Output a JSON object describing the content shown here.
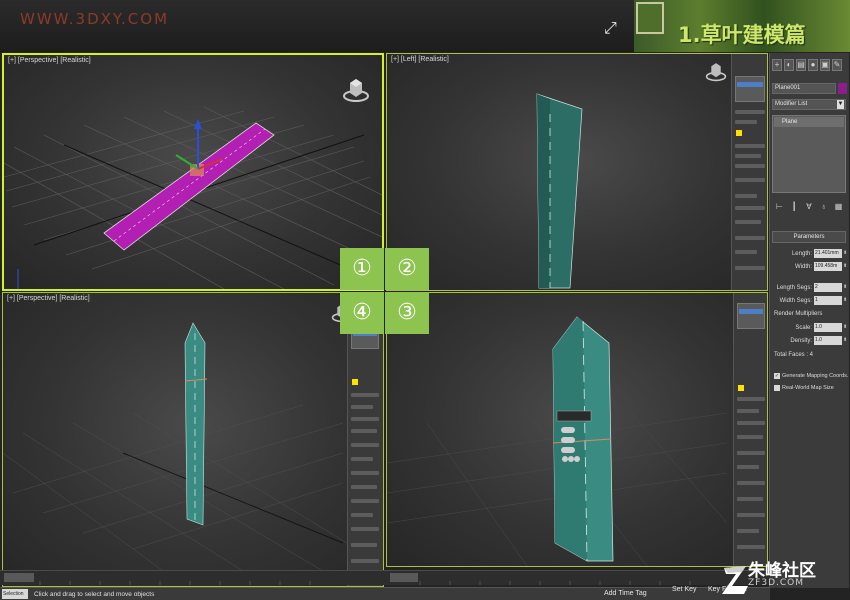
{
  "banner": {
    "watermark": "WWW.3DXY.COM",
    "section_title": "1.草叶建模篇"
  },
  "viewports": {
    "vp1_label": "[+] [Perspective] [Realistic]",
    "vp2_label": "[+] [Left] [Realistic]",
    "vp3_label": "",
    "vp4_label": "[+] [Perspective] [Realistic]"
  },
  "number_buttons": [
    "①",
    "②",
    "④",
    "③"
  ],
  "command_panel": {
    "object_name": "Plane001",
    "modifier_list": "Modifier List",
    "stack_item": "Plane",
    "rollout_title": "Parameters",
    "params": [
      {
        "label": "Length:",
        "value": "21.401mm"
      },
      {
        "label": "Width:",
        "value": "109.458m"
      },
      {
        "label": "Length Segs:",
        "value": "2"
      },
      {
        "label": "Width Segs:",
        "value": "1"
      }
    ],
    "render_multipliers": "Render Multipliers",
    "scale": {
      "label": "Scale:",
      "value": "1.0"
    },
    "density": {
      "label": "Density:",
      "value": "1.0"
    },
    "total_faces": "Total Faces : 4",
    "checks": [
      {
        "label": "Generate Mapping Coords.",
        "checked": true
      },
      {
        "label": "Real-World Map Size",
        "checked": false
      }
    ]
  },
  "status": {
    "selector": "Selection",
    "message": "Click and drag to select and move objects",
    "add_time_tag": "Add Time Tag",
    "set_key": "Set Key",
    "key_filters": "Key Filters..."
  },
  "site": {
    "name": "朱峰社区",
    "url": "ZF3D.COM"
  },
  "colors": {
    "accent_green": "#8dc34f",
    "viewport_active_border": "#d4f026",
    "plane_magenta": "#b21fb2",
    "blade_teal": "#3a8c82"
  }
}
